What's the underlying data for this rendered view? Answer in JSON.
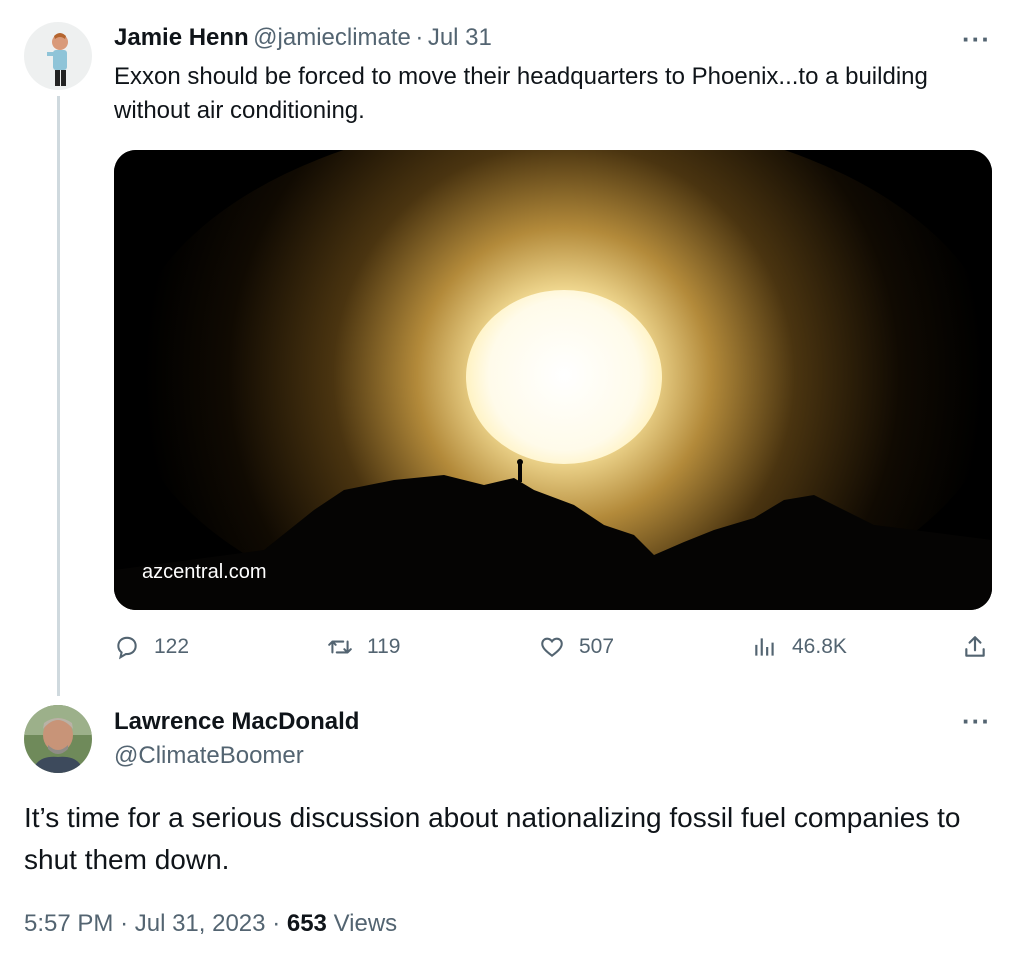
{
  "parent_tweet": {
    "author_name": "Jamie Henn",
    "author_handle": "@jamieclimate",
    "separator": "·",
    "date": "Jul 31",
    "more_label": "···",
    "text": "Exxon should be forced to move their headquarters to Phoenix...to a building without air conditioning.",
    "media": {
      "caption": "azcentral.com",
      "description": "sunset"
    },
    "actions": {
      "replies": "122",
      "retweets": "119",
      "likes": "507",
      "views": "46.8K"
    }
  },
  "reply_tweet": {
    "author_name": "Lawrence MacDonald",
    "author_handle": "@ClimateBoomer",
    "more_label": "···",
    "text": "It’s time for a serious discussion about nationalizing fossil fuel companies to shut them down.",
    "time": "5:57 PM",
    "dot": "·",
    "date": "Jul 31, 2023",
    "dot2": "·",
    "views_count": "653",
    "views_label": "Views"
  },
  "colors": {
    "text_primary": "#0f1419",
    "text_secondary": "#536471",
    "thread_line": "#cfd9de"
  }
}
